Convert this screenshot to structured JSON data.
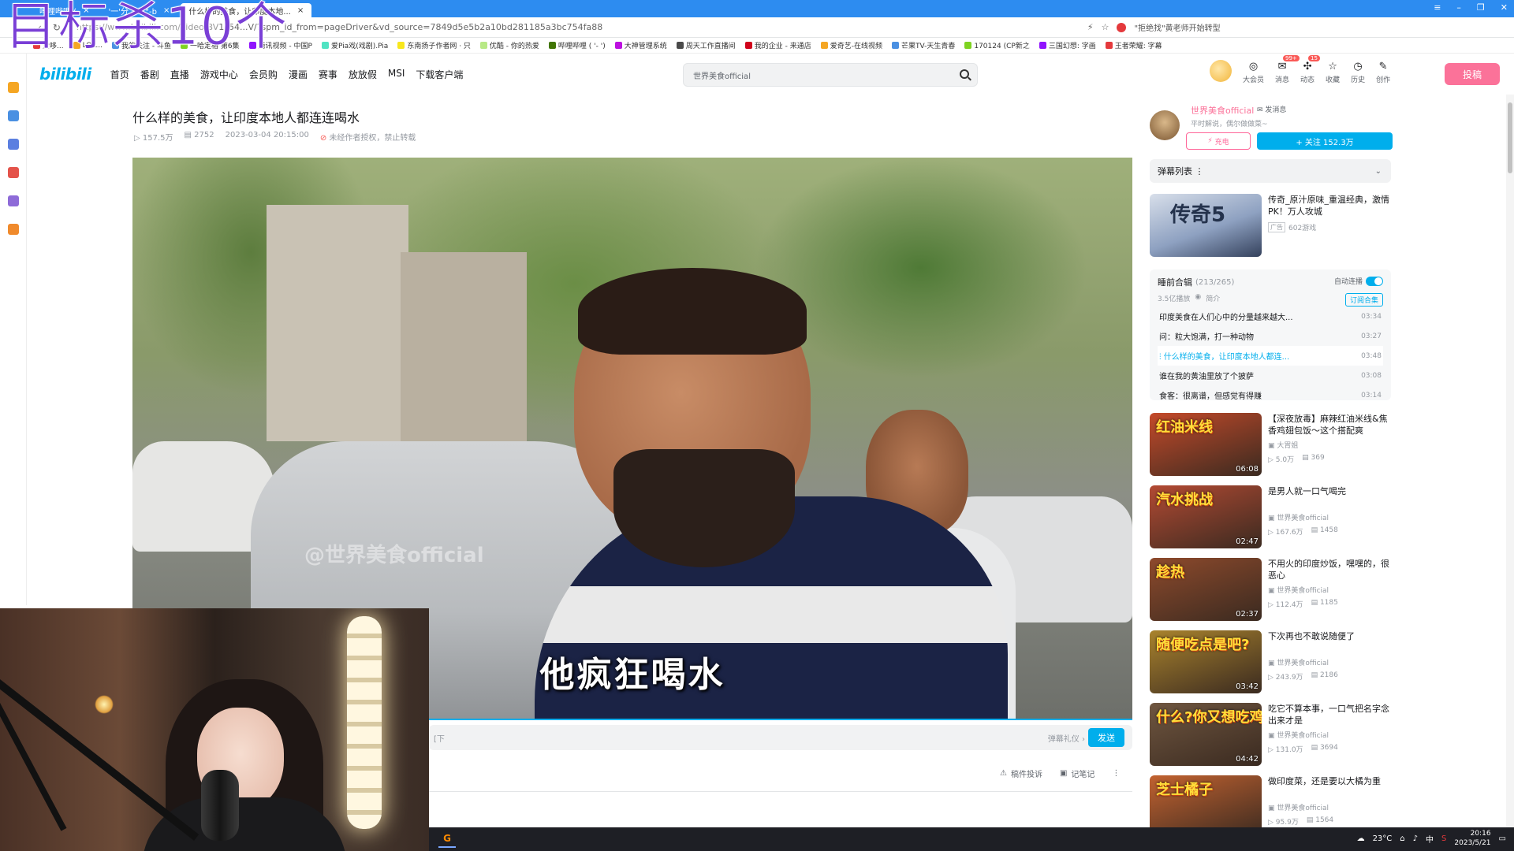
{
  "overlay_text": "目标杀10个",
  "browser": {
    "tabs": [
      {
        "label": "哔哩哔哩 (",
        "active": false
      },
      {
        "label": "'一'分 -\"弓\"-b",
        "active": false
      },
      {
        "label": "什么样的美食，让印度本地...",
        "active": true
      }
    ],
    "url_host": "https://www.bilibili.com/video/BV",
    "url_path": "1s54...V/?spm_id_from=pageDriver&vd_source=7849d5e5b2a10bd281185a3bc754fa88",
    "search_hint": "\"拒绝找\"黄老师开始转型",
    "bookmarks": [
      "爱哆...",
      "LOL...",
      "我的关注 - 斗鱼",
      "一哈定格 第6集",
      "腾讯视频 - 中国P",
      "爱Pia戏(戏剧).Pia",
      "东南扬子作者网 · 只",
      "优酷 - 你的热爱",
      "哔哩哔哩 ( '- ')",
      "大神管理系统",
      "周天工作直播间",
      "我的企业 - 来通店",
      "爱奇艺-在线视频",
      "芒果TV-天生青春",
      "170124 (CP新之",
      "三国幻想: 字画",
      "王者荣耀: 字幕"
    ]
  },
  "header": {
    "logo": "bilibili",
    "nav": [
      "首页",
      "番剧",
      "直播",
      "游戏中心",
      "会员购",
      "漫画",
      "赛事",
      "放放假",
      "MSI",
      "下载客户端"
    ],
    "search_placeholder": "世界美食official",
    "right_items": [
      {
        "label": "大会员",
        "glyph": "◎",
        "badge": ""
      },
      {
        "label": "消息",
        "glyph": "✉",
        "badge": "99+"
      },
      {
        "label": "动态",
        "glyph": "✣",
        "badge": "15"
      },
      {
        "label": "收藏",
        "glyph": "☆",
        "badge": ""
      },
      {
        "label": "历史",
        "glyph": "◷",
        "badge": ""
      },
      {
        "label": "创作",
        "glyph": "✎",
        "badge": ""
      }
    ],
    "upload_label": "投稿"
  },
  "video": {
    "title": "什么样的美食，让印度本地人都连连喝水",
    "views": "157.5万",
    "danmaku_count": "2752",
    "date": "2023-03-04 20:15:00",
    "notice": "未经作者授权，禁止转载",
    "watermark": "@世界美食official",
    "subtitle": "他疯狂喝水",
    "danmaku_placeholder": "[下",
    "danmaku_etiquette": "弹幕礼仪 ›",
    "send_label": "发送",
    "tools": [
      "稿件投诉",
      "记笔记"
    ]
  },
  "uploader": {
    "name": "世界美食official",
    "msg": "发消息",
    "desc": "平时解说，偶尔做做菜~",
    "charge": "充电",
    "follow": "+ 关注 152.3万"
  },
  "danmaku_list_label": "弹幕列表",
  "ad": {
    "thumb_text": "传奇5",
    "title": "传奇_原汁原味_重温经典，激情PK！万人攻城",
    "tag": "广告",
    "meta": "602游戏"
  },
  "series": {
    "title": "睡前合辑",
    "count": "(213/265)",
    "autoplay": "自动连播",
    "plays": "3.5亿播放",
    "intro": "简介",
    "subscribe": "订阅合集",
    "episodes": [
      {
        "title": "印度美食在人们心中的分量越来越大...",
        "dur": "03:34",
        "active": false
      },
      {
        "title": "问：粒大饱满，打一种动物",
        "dur": "03:27",
        "active": false
      },
      {
        "title": "什么样的美食，让印度本地人都连...",
        "dur": "03:48",
        "active": true
      },
      {
        "title": "谁在我的黄油里放了个披萨",
        "dur": "03:08",
        "active": false
      },
      {
        "title": "食客：很离谱，但感觉有得赚",
        "dur": "03:14",
        "active": false
      }
    ]
  },
  "recommendations": [
    {
      "cap": "红油米线",
      "dur": "06:08",
      "title": "【深夜放毒】麻辣红油米线&焦香鸡翅包饭～这个搭配爽",
      "up": "大胃姐",
      "views": "5.0万",
      "dm": "369",
      "color": "#c44a2a"
    },
    {
      "cap": "汽水挑战",
      "dur": "02:47",
      "title": "是男人就一口气喝完",
      "up": "世界美食official",
      "views": "167.6万",
      "dm": "1458",
      "color": "#b34a33"
    },
    {
      "cap": "趁热",
      "dur": "02:37",
      "title": "不用火的印度炒饭，嘿嘿的，很恶心",
      "up": "世界美食official",
      "views": "112.4万",
      "dm": "1185",
      "color": "#8e4a2c"
    },
    {
      "cap": "随便吃点是吧?",
      "dur": "03:42",
      "title": "下次再也不敢说随便了",
      "up": "世界美食official",
      "views": "243.9万",
      "dm": "2186",
      "color": "#a9832d"
    },
    {
      "cap": "什么?你又想吃鸡蛋?",
      "dur": "04:42",
      "title": "吃它不算本事，一口气把名字念出来才是",
      "up": "世界美食official",
      "views": "131.0万",
      "dm": "3694",
      "color": "#6f5640"
    },
    {
      "cap": "芝士橘子",
      "dur": "",
      "title": "做印度菜，还是要以大橘为重",
      "up": "世界美食official",
      "views": "95.9万",
      "dm": "1564",
      "color": "#c26230"
    }
  ],
  "taskbar": {
    "weather": "23°C",
    "ime": "中",
    "time": "20:16",
    "date": "2023/5/21"
  }
}
